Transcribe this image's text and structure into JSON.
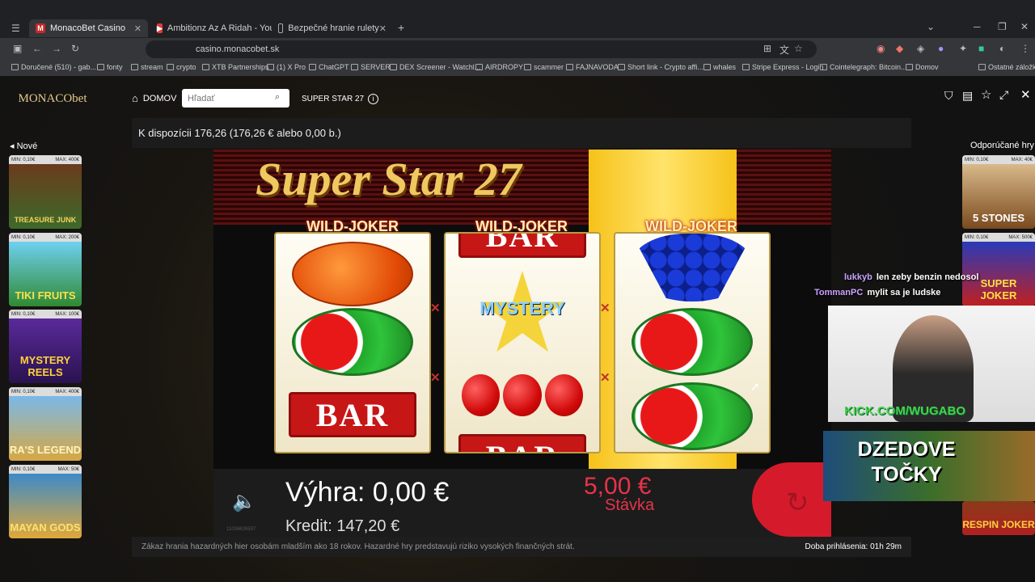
{
  "browser": {
    "tabs": [
      {
        "label": "MonacoBet Casino",
        "active": true
      },
      {
        "label": "Ambitionz Az A Ridah - YouTub",
        "active": false
      },
      {
        "label": "Bezpečné hranie rulety",
        "active": false
      }
    ],
    "url": "casino.monacobet.sk",
    "bookmarks": [
      "Doručené (510) - gab...",
      "fonty",
      "stream",
      "crypto",
      "XTB Partnerships",
      "(1) X Pro",
      "ChatGPT",
      "SERVER",
      "DEX Screener - Watchl...",
      "AIRDROPY",
      "scammer",
      "FAJNAVODA",
      "Short link - Crypto affi...",
      "whales",
      "Stripe Express - Login",
      "Cointelegraph: Bitcoin...",
      "Domov",
      "Ostatné záložky"
    ]
  },
  "site": {
    "logo": "MONACObet",
    "nav_home": "DOMOV",
    "search_placeholder": "Hľadať",
    "game_title": "SUPER STAR 27",
    "balance": "K dispozícii 176,26 (176,26 € alebo 0,00 b.)",
    "left_heading": "Nové",
    "right_heading": "Odporúčané hry",
    "left_games": [
      {
        "min": "MIN: 0,10€",
        "max": "MAX: 400€",
        "name": "TREASURE JUNK"
      },
      {
        "min": "MIN: 0,10€",
        "max": "MAX: 200€",
        "name": "TIKI FRUITS"
      },
      {
        "min": "MIN: 0,10€",
        "max": "MAX: 100€",
        "name": "MYSTERY REELS"
      },
      {
        "min": "MIN: 0,10€",
        "max": "MAX: 400€",
        "name": "RA'S LEGEND"
      },
      {
        "min": "MIN: 0,10€",
        "max": "MAX: 50€",
        "name": "MAYAN GODS"
      }
    ],
    "right_games": [
      {
        "min": "MIN: 0,10€",
        "max": "MAX: 40€",
        "name": "5 STONES"
      },
      {
        "min": "MIN: 0,10€",
        "max": "MAX: 500€",
        "name": "SUPER JOKER"
      },
      {
        "min": "",
        "max": "",
        "name": "RESPIN JOKER"
      }
    ],
    "footer_warning": "Zákaz hrania hazardných hier osobám mladším ako 18 rokov. Hazardné hry predstavujú riziko vysokých finančných strát.",
    "session_time": "Doba prihlásenia: 01h 29m"
  },
  "slot": {
    "title": "Super Star 27",
    "wild_label": "WILD-JOKER",
    "win_label": "Výhra:",
    "win_value": "0,00 €",
    "credit_label": "Kredit:",
    "credit_value": "147,20 €",
    "bet_value": "5,00 €",
    "bet_label": "Stávka",
    "mystery_label": "MYSTERY",
    "bar_label": "BAR",
    "game_id": "11004826597"
  },
  "stream": {
    "chat": [
      {
        "user": "lukkyb",
        "text": "len zeby benzin nedosol"
      },
      {
        "user": "TommanPC",
        "text": "mylit sa je ludske"
      }
    ],
    "webcam_caption": "KICK.COM/WUGABO",
    "banner_text": "DZEDOVE TOČKY"
  }
}
